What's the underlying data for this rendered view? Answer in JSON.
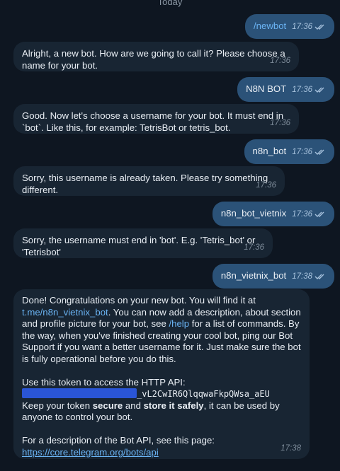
{
  "date_label": "Today",
  "messages": [
    {
      "dir": "out",
      "text": "/newbot",
      "time": "17:36"
    },
    {
      "dir": "in",
      "text": "Alright, a new bot. How are we going to call it? Please choose a name for your bot.",
      "time": "17:36"
    },
    {
      "dir": "out",
      "text": "N8N BOT",
      "time": "17:36"
    },
    {
      "dir": "in",
      "text": "Good. Now let's choose a username for your bot. It must end in `bot`. Like this, for example: TetrisBot or tetris_bot.",
      "time": "17:36"
    },
    {
      "dir": "out",
      "text": "n8n_bot",
      "time": "17:36"
    },
    {
      "dir": "in",
      "text": "Sorry, this username is already taken. Please try something different.",
      "time": "17:36"
    },
    {
      "dir": "out",
      "text": "n8n_bot_vietnix",
      "time": "17:36"
    },
    {
      "dir": "in",
      "text": "Sorry, the username must end in 'bot'. E.g. 'Tetris_bot' or 'Tetrisbot'",
      "time": "17:36"
    },
    {
      "dir": "out",
      "text": "n8n_vietnix_bot",
      "time": "17:38"
    }
  ],
  "final_message": {
    "p1_a": "Done! Congratulations on your new bot. You will find it at ",
    "p1_link": "t.me/n8n_vietnix_bot",
    "p1_b": ". You can now add a description, about section and profile picture for your bot, see ",
    "p1_help": "/help",
    "p1_c": " for a list of commands. By the way, when you've finished creating your cool bot, ping our Bot Support if you want a better username for it. Just make sure the bot is fully operational before you do this.",
    "p2_a": "Use this token to access the HTTP API:",
    "token_visible": "_vL2CwIR6QlqqwaFkpQWsa_aEU",
    "p2_b": "Keep your token ",
    "p2_bold1": "secure",
    "p2_c": " and ",
    "p2_bold2": "store it safely",
    "p2_d": ", it can be used by anyone to control your bot.",
    "p3_a": "For a description of the Bot API, see this page: ",
    "p3_link": "https://core.telegram.org/bots/api",
    "time": "17:38"
  },
  "colors": {
    "background": "#0e1621",
    "incoming_bubble": "#182533",
    "outgoing_bubble": "#2b5278",
    "link": "#6ab3f3",
    "redaction": "#2a55d6"
  },
  "icons": {
    "read_receipt": "double-check-icon"
  }
}
